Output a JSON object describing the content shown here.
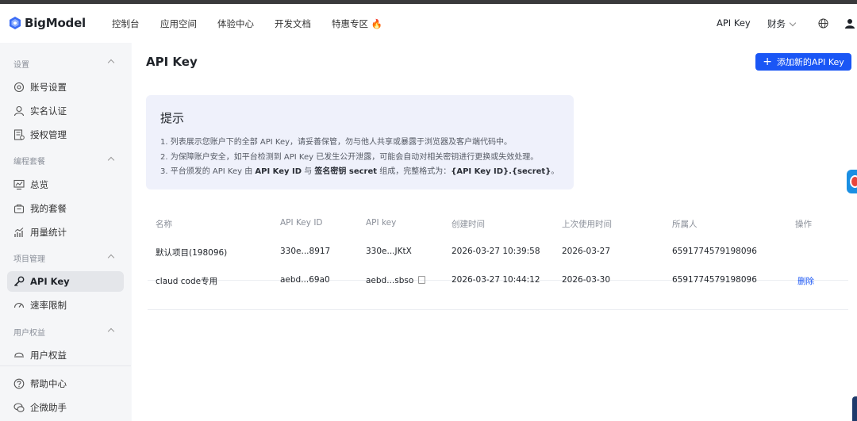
{
  "nav": {
    "brand": "BigModel",
    "items": [
      "控制台",
      "应用空间",
      "体验中心",
      "开发文档",
      "特惠专区 🔥"
    ],
    "api_key": "API Key",
    "finance": "财务"
  },
  "sidebar": {
    "sections": {
      "settings": "设置",
      "plans": "编程套餐",
      "project": "项目管理",
      "benefits": "用户权益"
    },
    "items": {
      "account": "账号设置",
      "realname": "实名认证",
      "auth": "授权管理",
      "overview": "总览",
      "myplan": "我的套餐",
      "usage": "用量统计",
      "apikey": "API Key",
      "ratelimit": "速率限制",
      "userbenefit": "用户权益",
      "help": "帮助中心",
      "wecom": "企微助手"
    }
  },
  "main": {
    "title": "API Key",
    "add_button": "添加新的API Key",
    "tip": {
      "title": "提示",
      "line1": "1. 列表展示您账户下的全部 API Key，请妥善保管，勿与他人共享或暴露于浏览器及客户端代码中。",
      "line2": "2. 为保障账户安全，如平台检测到 API Key 已发生公开泄露，可能会自动对相关密钥进行更换或失效处理。",
      "line3_pre": "3. 平台颁发的 API Key 由 ",
      "line3_b1": "API Key ID",
      "line3_mid": " 与 ",
      "line3_b2": "签名密钥 secret",
      "line3_post": " 组成，完整格式为：",
      "line3_b3": "{API Key ID}.{secret}",
      "line3_end": "。"
    },
    "table": {
      "headers": [
        "名称",
        "API Key ID",
        "API key",
        "创建时间",
        "上次使用时间",
        "所属人",
        "操作"
      ],
      "rows": [
        {
          "name": "默认项目(198096)",
          "key_id": "330e...8917",
          "key": "330e...JKtX",
          "created": "2026-03-27 10:39:58",
          "last_used": "2026-03-27",
          "owner": "6591774579198096",
          "action": ""
        },
        {
          "name": "claud code专用",
          "key_id": "aebd...69a0",
          "key": "aebd...sbso",
          "created": "2026-03-27 10:44:12",
          "last_used": "2026-03-30",
          "owner": "6591774579198096",
          "action": "删除"
        }
      ]
    }
  },
  "colors": {
    "primary": "#1a56f5",
    "tip_bg": "#eff1fb",
    "sidebar_bg": "#f5f6f8",
    "active_item_bg": "#e4e6ea"
  }
}
